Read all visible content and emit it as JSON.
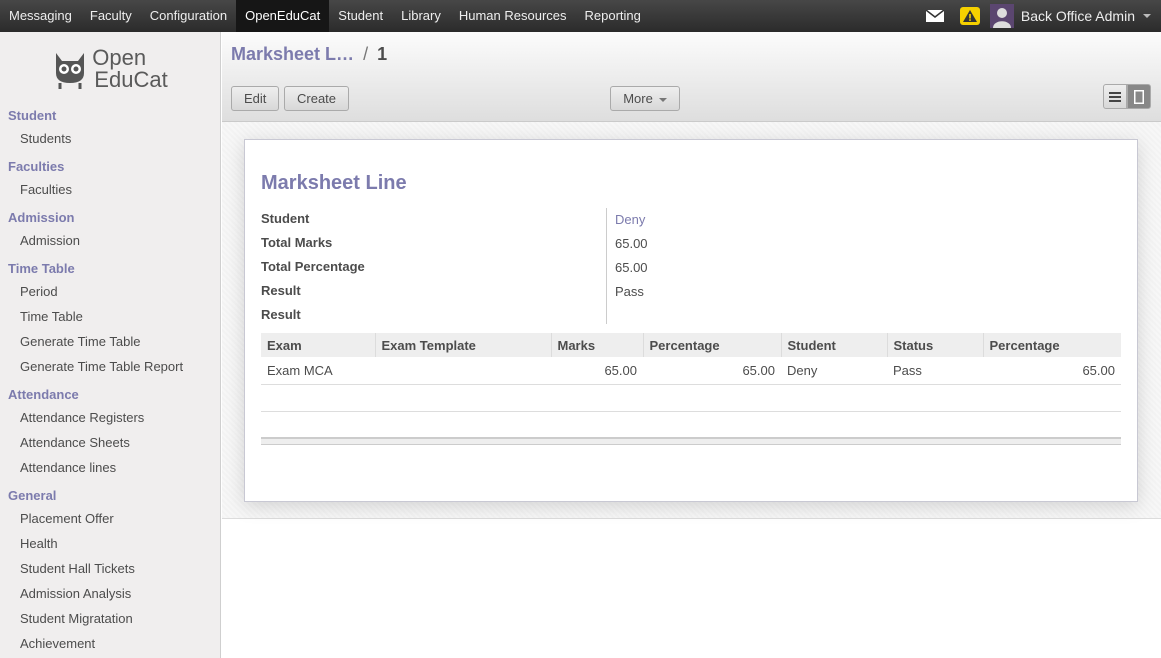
{
  "topnav": {
    "items": [
      "Messaging",
      "Faculty",
      "Configuration",
      "OpenEduCat",
      "Student",
      "Library",
      "Human Resources",
      "Reporting"
    ],
    "active_index": 3,
    "user_name": "Back Office Admin"
  },
  "sidebar": {
    "logo_line1": "Open",
    "logo_line2": "EduCat",
    "sections": [
      {
        "title": "Student",
        "items": [
          "Students"
        ]
      },
      {
        "title": "Faculties",
        "items": [
          "Faculties"
        ]
      },
      {
        "title": "Admission",
        "items": [
          "Admission"
        ]
      },
      {
        "title": "Time Table",
        "items": [
          "Period",
          "Time Table",
          "Generate Time Table",
          "Generate Time Table Report"
        ]
      },
      {
        "title": "Attendance",
        "items": [
          "Attendance Registers",
          "Attendance Sheets",
          "Attendance lines"
        ]
      },
      {
        "title": "General",
        "items": [
          "Placement Offer",
          "Health",
          "Student Hall Tickets",
          "Admission Analysis",
          "Student Migratation",
          "Achievement"
        ]
      }
    ]
  },
  "breadcrumb": {
    "parent": "Marksheet L…",
    "separator": "/",
    "current": "1"
  },
  "toolbar": {
    "edit_label": "Edit",
    "create_label": "Create",
    "more_label": "More"
  },
  "form": {
    "title": "Marksheet Line",
    "fields": [
      {
        "label": "Student",
        "value": "Deny"
      },
      {
        "label": "Total Marks",
        "value": "65.00"
      },
      {
        "label": "Total Percentage",
        "value": "65.00"
      },
      {
        "label": "Result",
        "value": "Pass"
      },
      {
        "label": "Result",
        "value": ""
      }
    ],
    "table": {
      "headers": [
        "Exam",
        "Exam Template",
        "Marks",
        "Percentage",
        "Student",
        "Status",
        "Percentage"
      ],
      "rows": [
        [
          "Exam MCA",
          "",
          "65.00",
          "65.00",
          "Deny",
          "Pass",
          "65.00"
        ]
      ]
    }
  },
  "colors": {
    "accent": "#7c7bad",
    "topbar": "#2b2b2b"
  }
}
